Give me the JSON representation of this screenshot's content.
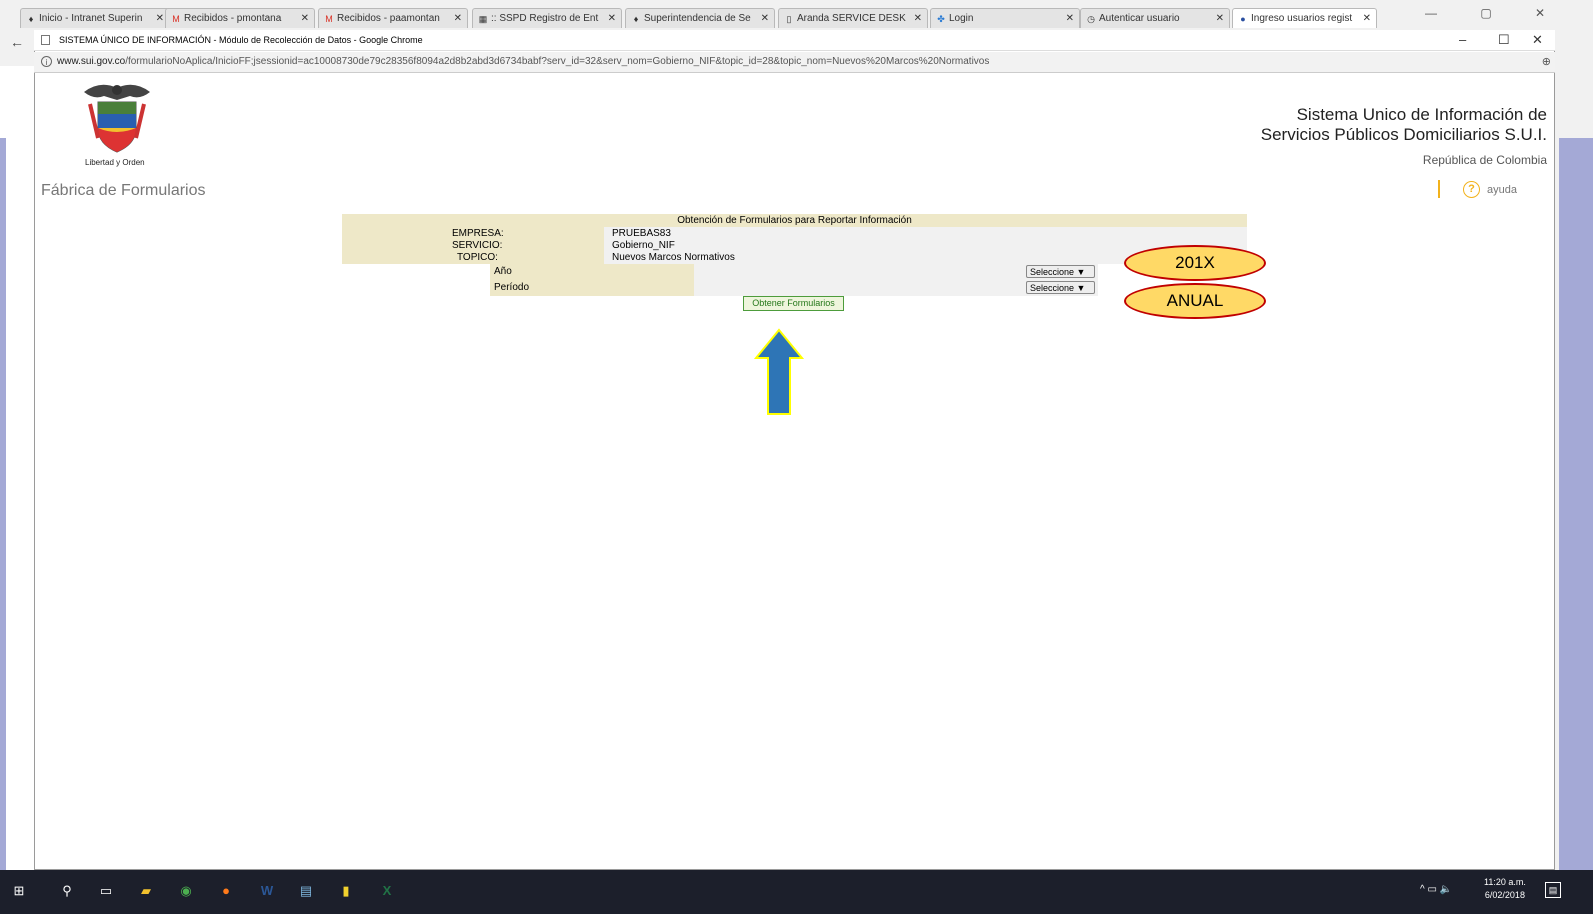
{
  "background_tabs": [
    {
      "label": "Inicio - Intranet Superin",
      "icon": "intranet-icon"
    },
    {
      "label": "Recibidos - pmontana",
      "icon": "gmail-icon"
    },
    {
      "label": "Recibidos - paamontan",
      "icon": "gmail-icon"
    },
    {
      "label": ":: SSPD Registro de Ent",
      "icon": "sspd-icon"
    },
    {
      "label": "Superintendencia de Se",
      "icon": "intranet-icon"
    },
    {
      "label": "Aranda SERVICE DESK",
      "icon": "page-icon"
    },
    {
      "label": "Login",
      "icon": "login-icon"
    },
    {
      "label": "Autenticar usuario",
      "icon": "clock-icon"
    },
    {
      "label": "Ingreso usuarios regist",
      "icon": "user-icon"
    }
  ],
  "popup": {
    "title": "SISTEMA ÚNICO DE INFORMACIÓN - Módulo de Recolección de Datos - Google Chrome",
    "url_host": "www.sui.gov.co",
    "url_path": "/formularioNoAplica/InicioFF;jsessionid=ac10008730de79c28356f8094a2d8b2abd3d6734babf?serv_id=32&serv_nom=Gobierno_NIF&topic_id=28&topic_nom=Nuevos%20Marcos%20Normativos"
  },
  "header": {
    "crest_caption": "Libertad y Orden",
    "sui_title_line1": "Sistema Unico de Información de",
    "sui_title_line2": "Servicios Públicos Domiciliarios S.U.I.",
    "country": "República de Colombia",
    "section": "Fábrica de Formularios",
    "help_label": "ayuda"
  },
  "form": {
    "title": "Obtención de Formularios para Reportar Información",
    "empresa_label": "EMPRESA:",
    "empresa_value": "PRUEBAS83",
    "servicio_label": "SERVICIO:",
    "servicio_value": "Gobierno_NIF",
    "topico_label": "TOPICO:",
    "topico_value": "Nuevos Marcos Normativos",
    "anio_label": "Año",
    "anio_select": "Seleccione",
    "periodo_label": "Período",
    "periodo_select": "Seleccione",
    "submit_label": "Obtener Formularios"
  },
  "annotations": {
    "anio_hint": "201X",
    "periodo_hint": "ANUAL",
    "colors": {
      "fill": "#ffd966",
      "stroke": "#c00000",
      "arrow": "#2e75b6",
      "arrow_outline": "#ffff00"
    }
  },
  "taskbar": {
    "time": "11:20 a.m.",
    "date": "6/02/2018"
  }
}
